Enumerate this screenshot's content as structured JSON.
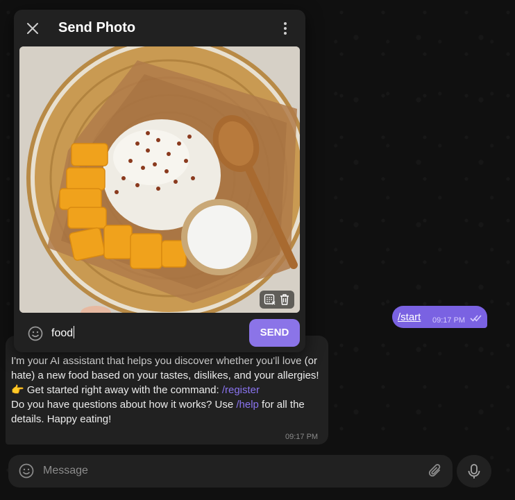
{
  "modal": {
    "title": "Send Photo",
    "caption_value": "food",
    "send_label": "SEND"
  },
  "messages": {
    "outgoing": {
      "text": "/start",
      "time": "09:17 PM"
    },
    "incoming": {
      "line1": "I'm your AI assistant that helps you discover whether you'll love (or hate) a new food based on your tastes, dislikes, and your allergies!",
      "line2_prefix": "👉 Get started right away with the command: ",
      "line2_link": "/register",
      "line3_prefix": "Do you have questions about how it works? Use ",
      "line3_link": "/help",
      "line3_suffix": " for all the details. Happy eating!",
      "time": "09:17 PM"
    }
  },
  "composer": {
    "placeholder": "Message"
  },
  "colors": {
    "accent": "#8b74e8",
    "outgoing_bubble": "#7a62e2",
    "link": "#8a74f0"
  },
  "icons": [
    "close-icon",
    "more-vertical-icon",
    "spoiler-icon",
    "trash-icon",
    "emoji-icon",
    "attach-icon",
    "microphone-icon",
    "double-check-icon"
  ]
}
